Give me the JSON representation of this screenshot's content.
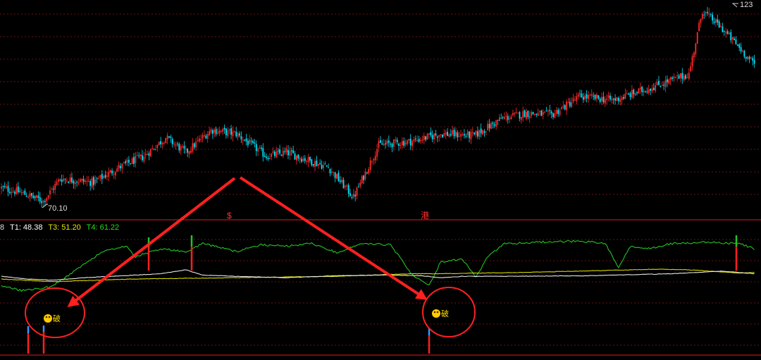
{
  "price_panel": {
    "high_label": "123",
    "low_label": "70.10",
    "markers": [
      "$",
      "港"
    ]
  },
  "indicator_panel": {
    "legend": [
      {
        "text": "8",
        "color": "#dddddd"
      },
      {
        "text": "T1: 48.38",
        "color": "#ffffff"
      },
      {
        "text": "T3: 51.20",
        "color": "#e6e600"
      },
      {
        "text": "T4: 61.22",
        "color": "#22dd22"
      }
    ],
    "signal_labels": [
      "破",
      "破"
    ]
  },
  "colors": {
    "up": "#ff2a2a",
    "down": "#00e5ff",
    "grid": "#8b1a1a",
    "separator": "#b01818",
    "green_line": "#22c422",
    "yellow_line": "#d8d800",
    "white_line": "#e8e8e8",
    "annotation": "#ff2020"
  },
  "chart_data": {
    "type": "candlestick",
    "title": "",
    "series": [
      {
        "type": "candlestick",
        "close_anchors": [
          [
            0,
            74.5
          ],
          [
            10,
            73.5
          ],
          [
            25,
            71.0
          ],
          [
            35,
            77.0
          ],
          [
            55,
            76.0
          ],
          [
            70,
            80.0
          ],
          [
            85,
            83.0
          ],
          [
            98,
            88.0
          ],
          [
            110,
            84.0
          ],
          [
            125,
            90.0
          ],
          [
            140,
            89.0
          ],
          [
            158,
            83.0
          ],
          [
            170,
            84.0
          ],
          [
            195,
            80.0
          ],
          [
            210,
            72.0
          ],
          [
            225,
            86.0
          ],
          [
            245,
            87.0
          ],
          [
            262,
            89.0
          ],
          [
            282,
            88.5
          ],
          [
            298,
            93.0
          ],
          [
            313,
            94.5
          ],
          [
            328,
            94.0
          ],
          [
            345,
            99.0
          ],
          [
            365,
            98.0
          ],
          [
            385,
            101.0
          ],
          [
            410,
            105.0
          ],
          [
            418,
            122.0
          ],
          [
            430,
            117.0
          ],
          [
            449,
            107.5
          ]
        ]
      },
      {
        "type": "line",
        "name": "T4",
        "anchors": [
          [
            0,
            52
          ],
          [
            12,
            48
          ],
          [
            30,
            51
          ],
          [
            45,
            64
          ],
          [
            60,
            78
          ],
          [
            75,
            82
          ],
          [
            80,
            74
          ],
          [
            95,
            80
          ],
          [
            110,
            78
          ],
          [
            120,
            84
          ],
          [
            140,
            78
          ],
          [
            155,
            83
          ],
          [
            170,
            82
          ],
          [
            185,
            84
          ],
          [
            200,
            77
          ],
          [
            215,
            84
          ],
          [
            232,
            83
          ],
          [
            245,
            60
          ],
          [
            255,
            52
          ],
          [
            262,
            70
          ],
          [
            275,
            72
          ],
          [
            283,
            58
          ],
          [
            290,
            74
          ],
          [
            300,
            84
          ],
          [
            320,
            85
          ],
          [
            345,
            86
          ],
          [
            360,
            84
          ],
          [
            368,
            66
          ],
          [
            375,
            82
          ],
          [
            385,
            80
          ],
          [
            400,
            84
          ],
          [
            420,
            85
          ],
          [
            440,
            84
          ],
          [
            449,
            80
          ]
        ]
      },
      {
        "type": "line",
        "name": "T3",
        "anchors": [
          [
            0,
            57
          ],
          [
            30,
            55
          ],
          [
            80,
            57
          ],
          [
            140,
            58
          ],
          [
            200,
            59
          ],
          [
            245,
            61
          ],
          [
            262,
            61
          ],
          [
            310,
            62
          ],
          [
            360,
            63.5
          ],
          [
            390,
            64.5
          ],
          [
            410,
            64
          ],
          [
            440,
            61.5
          ],
          [
            449,
            62
          ]
        ]
      },
      {
        "type": "line",
        "name": "T1",
        "anchors": [
          [
            0,
            59
          ],
          [
            15,
            57
          ],
          [
            30,
            56
          ],
          [
            50,
            58
          ],
          [
            80,
            60
          ],
          [
            95,
            61
          ],
          [
            110,
            64
          ],
          [
            120,
            60
          ],
          [
            140,
            59
          ],
          [
            170,
            58
          ],
          [
            200,
            59.5
          ],
          [
            230,
            60
          ],
          [
            250,
            59.5
          ],
          [
            262,
            58
          ],
          [
            275,
            59
          ],
          [
            300,
            59
          ],
          [
            350,
            59.5
          ],
          [
            400,
            61
          ],
          [
            430,
            63
          ],
          [
            449,
            61
          ]
        ]
      }
    ]
  }
}
